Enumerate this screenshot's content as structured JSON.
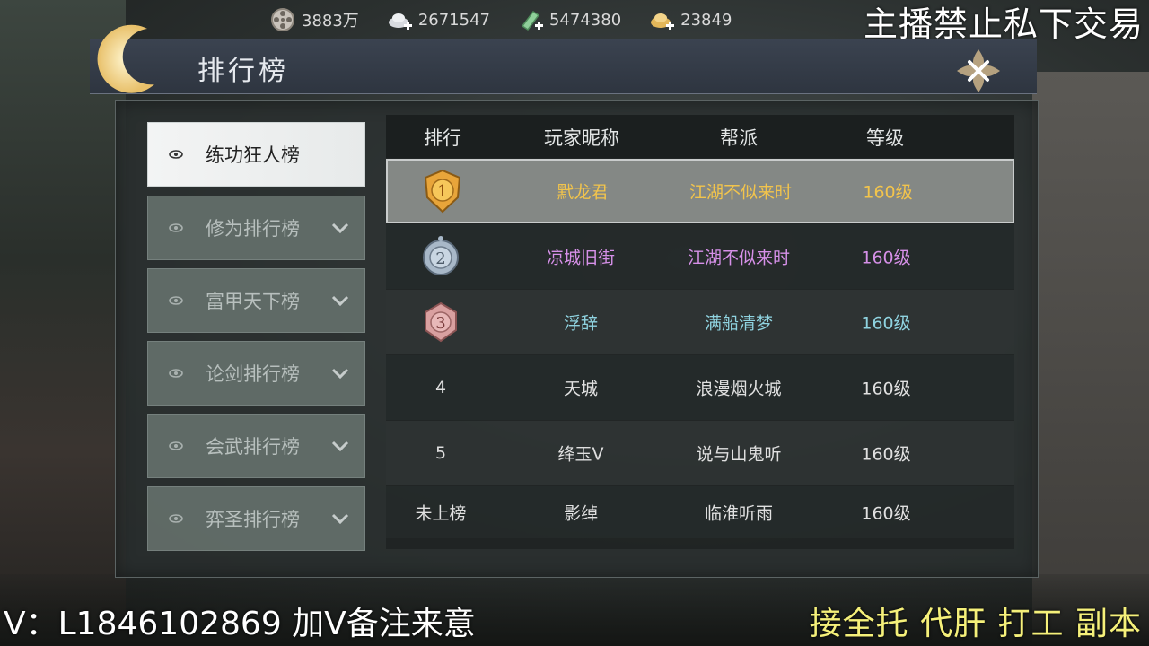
{
  "currencies": [
    {
      "icon": "film-reel-icon",
      "value": "3883万"
    },
    {
      "icon": "silver-ingot-plus-icon",
      "value": "2671547"
    },
    {
      "icon": "jade-plus-icon",
      "value": "5474380"
    },
    {
      "icon": "gold-ingot-plus-icon",
      "value": "23849"
    }
  ],
  "overlay_top": "主播禁止私下交易",
  "panel": {
    "title": "排行榜"
  },
  "sidebar": {
    "items": [
      {
        "label": "练功狂人榜",
        "active": true
      },
      {
        "label": "修为排行榜",
        "active": false
      },
      {
        "label": "富甲天下榜",
        "active": false
      },
      {
        "label": "论剑排行榜",
        "active": false
      },
      {
        "label": "会武排行榜",
        "active": false
      },
      {
        "label": "弈圣排行榜",
        "active": false
      }
    ]
  },
  "table": {
    "headers": [
      "排行",
      "玩家昵称",
      "帮派",
      "等级"
    ],
    "rows": [
      {
        "rank": "1",
        "name": "黓龙君",
        "guild": "江湖不似来时",
        "level": "160级",
        "color": "#f2c44c"
      },
      {
        "rank": "2",
        "name": "凉城旧街",
        "guild": "江湖不似来时",
        "level": "160级",
        "color": "#d690e8"
      },
      {
        "rank": "3",
        "name": "浮辞",
        "guild": "满船清梦",
        "level": "160级",
        "color": "#8fd3e0"
      },
      {
        "rank": "4",
        "name": "天城",
        "guild": "浪漫烟火城",
        "level": "160级",
        "color": "#e0e0e0"
      },
      {
        "rank": "5",
        "name": "绛玉ᐯ",
        "guild": "说与山鬼听",
        "level": "160级",
        "color": "#e0e0e0"
      },
      {
        "rank": "未上榜",
        "name": "影绰",
        "guild": "临淮听雨",
        "level": "160级",
        "color": "#e0e0e0"
      }
    ]
  },
  "overlay_bottom_left": "V：L1846102869 加V备注来意",
  "overlay_bottom_right": "接全托 代肝 打工 副本"
}
